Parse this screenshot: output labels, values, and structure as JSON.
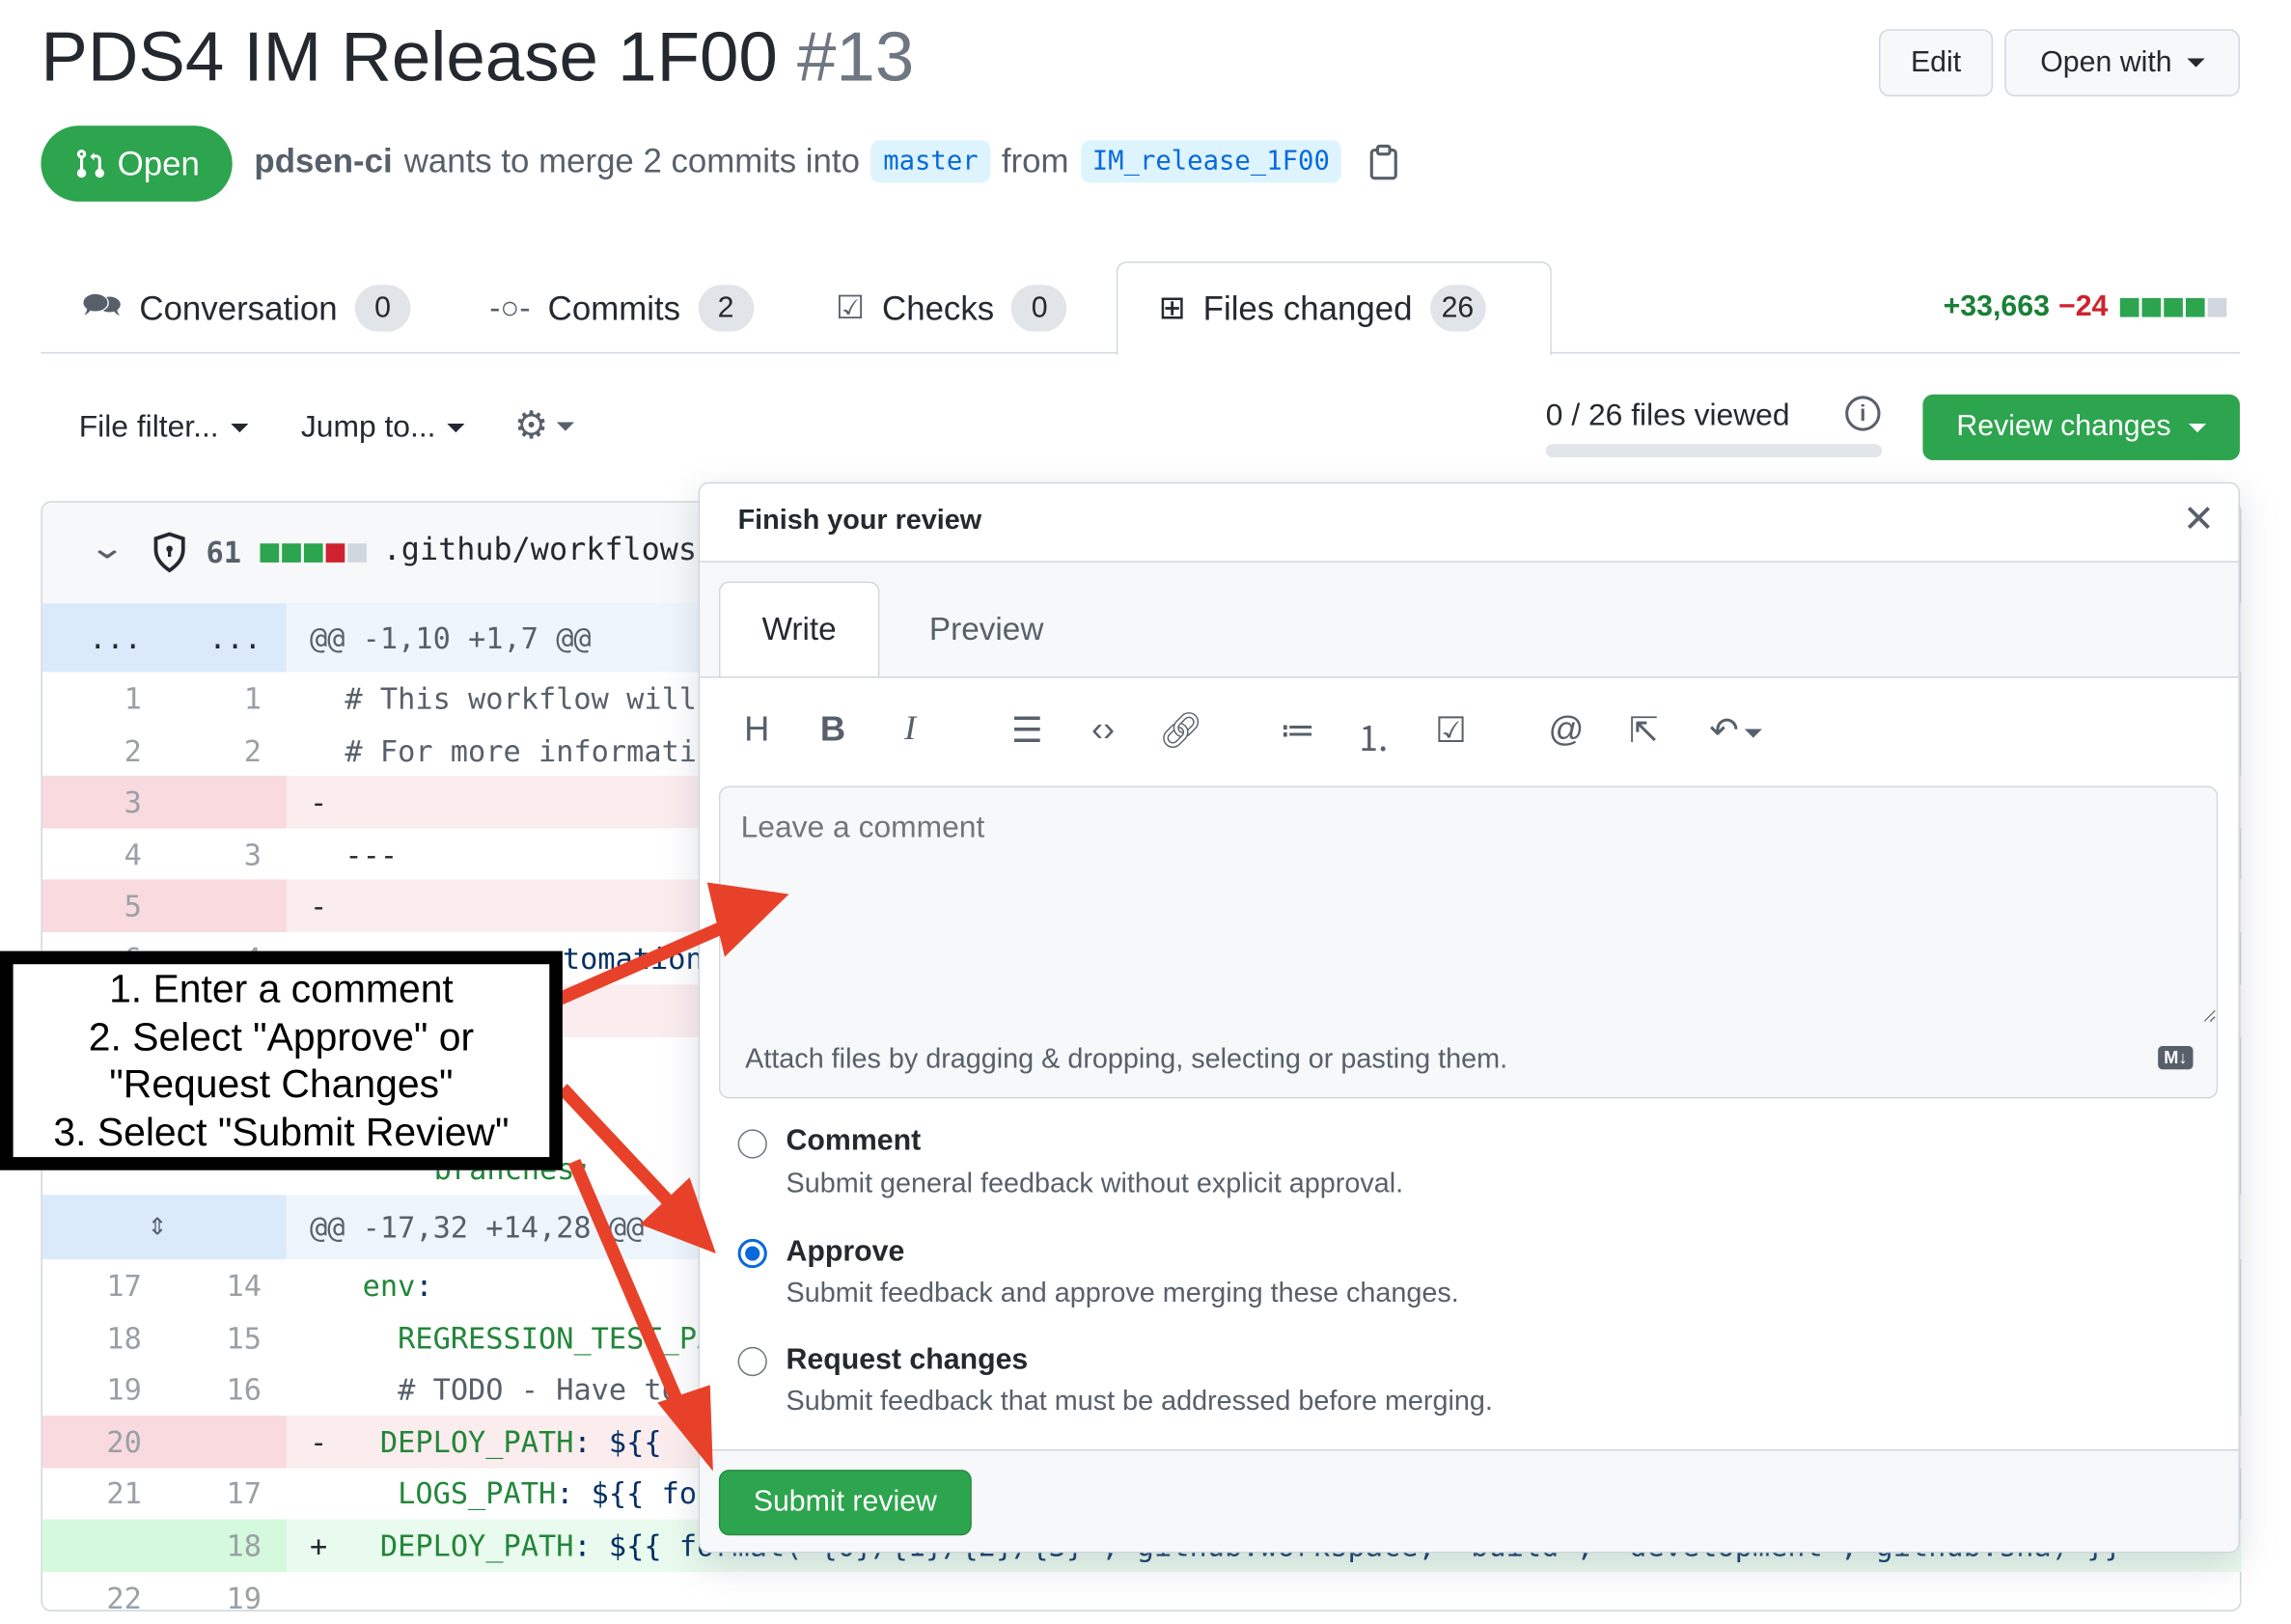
{
  "header": {
    "title": "PDS4 IM Release 1F00",
    "number": "#13",
    "edit_label": "Edit",
    "open_with_label": "Open with"
  },
  "status": {
    "state": "Open",
    "author": "pdsen-ci",
    "text": "wants to merge 2 commits into",
    "base": "master",
    "from": "from",
    "head": "IM_release_1F00"
  },
  "tabs": [
    {
      "label": "Conversation",
      "count": "0"
    },
    {
      "label": "Commits",
      "count": "2"
    },
    {
      "label": "Checks",
      "count": "0"
    },
    {
      "label": "Files changed",
      "count": "26"
    }
  ],
  "diffstat": {
    "additions": "+33,663",
    "deletions": "−24"
  },
  "toolbar": {
    "file_filter": "File filter...",
    "jump_to": "Jump to...",
    "files_viewed": "0 / 26 files viewed",
    "files_viewed_fraction": 0,
    "review_changes": "Review changes"
  },
  "file": {
    "changes": "61",
    "path": ".github/workflows/"
  },
  "diff": {
    "hunk1": {
      "left": "...",
      "right": "...",
      "text": "@@ -1,10 +1,7 @@"
    },
    "rows1": [
      {
        "n1": "1",
        "n2": "1",
        "code": "  # This workflow will",
        "type": "ctx"
      },
      {
        "n1": "2",
        "n2": "2",
        "code": "  # For more informati",
        "type": "ctx"
      },
      {
        "n1": "3",
        "n2": "",
        "code": "-",
        "type": "del"
      },
      {
        "n1": "4",
        "n2": "3",
        "code": "  ---",
        "type": "ctx"
      },
      {
        "n1": "5",
        "n2": "",
        "code": "-",
        "type": "del"
      }
    ],
    "partial_code": "tomation",
    "branches": "branches:",
    "hunk2": {
      "text": "@@ -17,32 +14,28 @@"
    },
    "rows2": [
      {
        "n1": "17",
        "n2": "14",
        "key": "env",
        "rest": ":",
        "prefix": " ",
        "indent": "  ",
        "type": "ctx"
      },
      {
        "n1": "18",
        "n2": "15",
        "key": "REGRESSION_TEST_PA",
        "rest": "",
        "prefix": " ",
        "indent": "    ",
        "type": "ctx"
      },
      {
        "n1": "19",
        "n2": "16",
        "key": "",
        "rest": "# TODO - Have to h",
        "prefix": " ",
        "indent": "    ",
        "type": "ctx"
      },
      {
        "n1": "20",
        "n2": "",
        "key": "DEPLOY_PATH",
        "rest": ": ${{",
        "prefix": "-",
        "indent": "   ",
        "type": "del"
      },
      {
        "n1": "21",
        "n2": "17",
        "key": "LOGS_PATH",
        "rest": ": ${{ for",
        "prefix": " ",
        "indent": "    ",
        "type": "ctx"
      },
      {
        "n1": "",
        "n2": "18",
        "key": "DEPLOY_PATH",
        "rest": ": ${{ format('{0}/{1}/{2}/{3}', github.workspace, 'build', 'development', github.sha) }}",
        "prefix": "+",
        "indent": "   ",
        "type": "add"
      },
      {
        "n1": "22",
        "n2": "19",
        "key": "",
        "rest": "",
        "prefix": " ",
        "indent": "",
        "type": "ctx"
      }
    ]
  },
  "review": {
    "title": "Finish your review",
    "tab_write": "Write",
    "tab_preview": "Preview",
    "placeholder": "Leave a comment",
    "attach": "Attach files by dragging & dropping, selecting or pasting them.",
    "options": [
      {
        "title": "Comment",
        "desc": "Submit general feedback without explicit approval.",
        "selected": false
      },
      {
        "title": "Approve",
        "desc": "Submit feedback and approve merging these changes.",
        "selected": true
      },
      {
        "title": "Request changes",
        "desc": "Submit feedback that must be addressed before merging.",
        "selected": false
      }
    ],
    "submit": "Submit review"
  },
  "annotation": {
    "lines": [
      "1. Enter a comment",
      "2. Select \"Approve\" or",
      "\"Request Changes\"",
      "3. Select \"Submit Review\""
    ]
  },
  "colors": {
    "green": "#2da44e",
    "red_arrow": "#e8412a",
    "link_blue": "#0969da",
    "deletion": "#cf222e"
  }
}
